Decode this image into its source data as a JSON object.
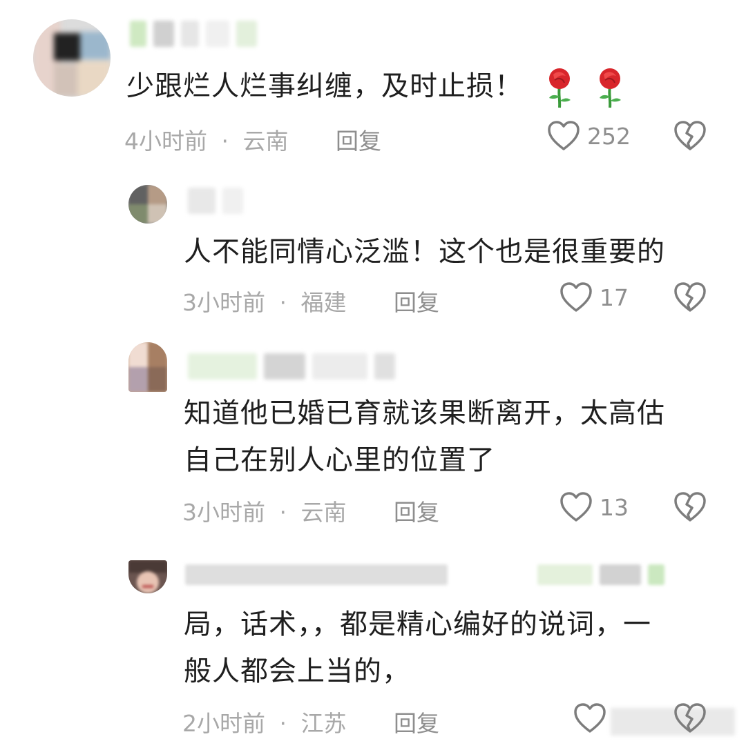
{
  "comments": [
    {
      "text": "少跟烂人烂事纠缠，及时止损！",
      "time": "4小时前",
      "location": "云南",
      "reply_label": "回复",
      "likes": "252",
      "emojis": [
        "rose",
        "rose"
      ]
    },
    {
      "text": "人不能同情心泛滥！这个也是很重要的",
      "time": "3小时前",
      "location": "福建",
      "reply_label": "回复",
      "likes": "17"
    },
    {
      "text_line1": "知道他已婚已育就该果断离开，太高估",
      "text_line2": "自己在别人心里的位置了",
      "time": "3小时前",
      "location": "云南",
      "reply_label": "回复",
      "likes": "13"
    },
    {
      "text_line1": "局，话术，，都是精心编好的说词，一",
      "text_line2": "般人都会上当的，",
      "time": "2小时前",
      "location": "江苏",
      "reply_label": "回复",
      "likes": ""
    }
  ],
  "separator": "·"
}
